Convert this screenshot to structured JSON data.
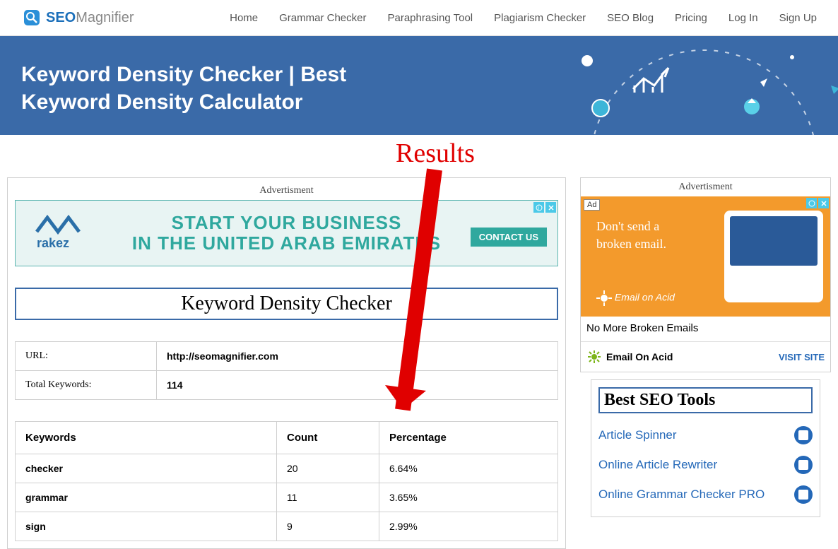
{
  "logo": {
    "seo": "SEO",
    "magnifier": "Magnifier"
  },
  "nav": {
    "items": [
      {
        "label": "Home"
      },
      {
        "label": "Grammar Checker"
      },
      {
        "label": "Paraphrasing Tool"
      },
      {
        "label": "Plagiarism Checker"
      },
      {
        "label": "SEO Blog"
      },
      {
        "label": "Pricing"
      },
      {
        "label": "Log In"
      },
      {
        "label": "Sign Up"
      }
    ]
  },
  "hero": {
    "title_line1": "Keyword Density Checker | Best",
    "title_line2": "Keyword Density Calculator"
  },
  "annotation": {
    "label": "Results"
  },
  "main": {
    "ad_label": "Advertisment",
    "ad_banner": {
      "line1": "START YOUR BUSINESS",
      "line2": "IN THE UNITED ARAB EMIRATES",
      "cta": "CONTACT US",
      "brand": "rakez"
    },
    "tool_title": "Keyword Density Checker",
    "info": {
      "url_label": "URL:",
      "url_value": "http://seomagnifier.com",
      "total_label": "Total Keywords:",
      "total_value": "114"
    },
    "results": {
      "headers": {
        "keyword": "Keywords",
        "count": "Count",
        "percentage": "Percentage"
      },
      "rows": [
        {
          "keyword": "checker",
          "count": "20",
          "percentage": "6.64%"
        },
        {
          "keyword": "grammar",
          "count": "11",
          "percentage": "3.65%"
        },
        {
          "keyword": "sign",
          "count": "9",
          "percentage": "2.99%"
        }
      ]
    }
  },
  "aside": {
    "ad_label": "Advertisment",
    "side_ad": {
      "badge": "Ad",
      "line1": "Don't send a",
      "line2": "broken email.",
      "logo": "Email on Acid",
      "caption": "No More Broken Emails",
      "brand": "Email On Acid",
      "visit": "VISIT SITE"
    },
    "tools": {
      "title": "Best SEO Tools",
      "items": [
        {
          "label": "Article Spinner"
        },
        {
          "label": "Online Article Rewriter"
        },
        {
          "label": "Online Grammar Checker PRO"
        }
      ]
    }
  }
}
